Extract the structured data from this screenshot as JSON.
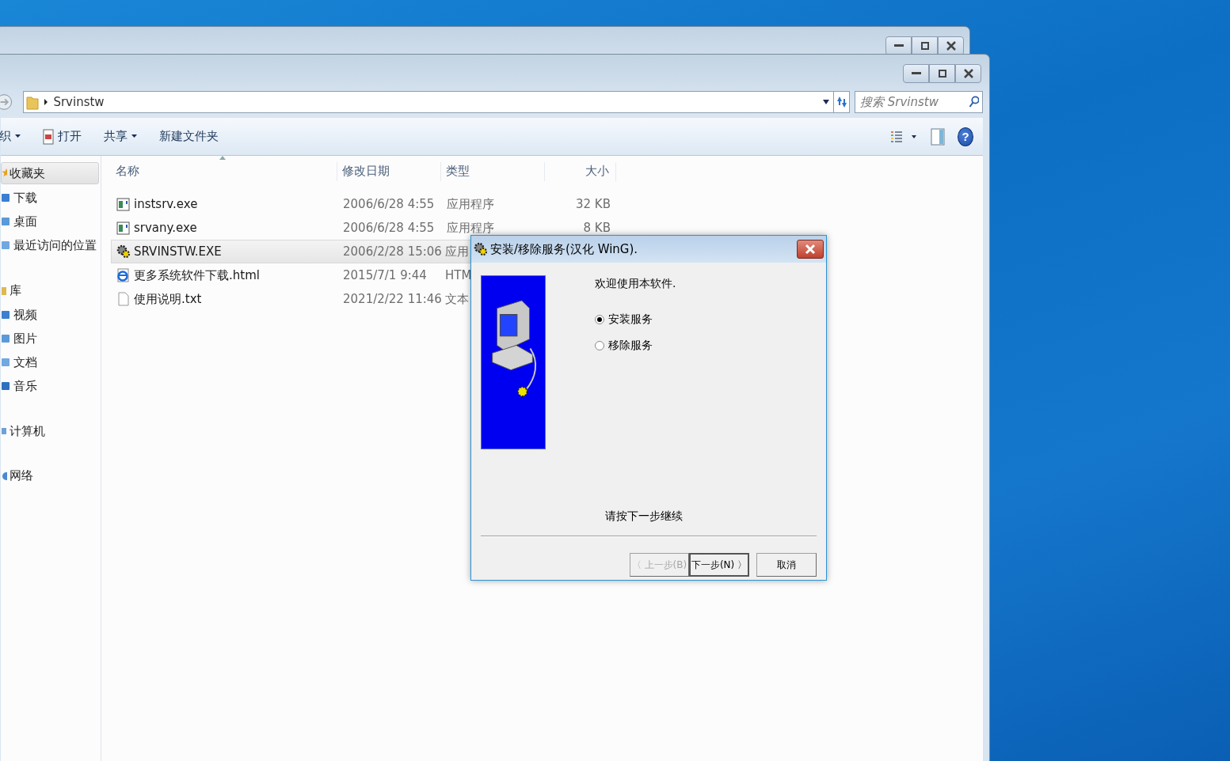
{
  "explorer": {
    "address": {
      "path": "Srvinstw"
    },
    "search": {
      "placeholder": "搜索 Srvinstw"
    },
    "toolbar": [
      {
        "label": "织",
        "kind": "menu"
      },
      {
        "label": "打开",
        "kind": "open"
      },
      {
        "label": "共享",
        "kind": "menu"
      },
      {
        "label": "新建文件夹",
        "kind": "plain"
      }
    ],
    "sidebar": [
      {
        "label": "收藏夹",
        "selected": true,
        "children": [
          {
            "label": "下载",
            "selected": false
          },
          {
            "label": "桌面",
            "selected": false
          },
          {
            "label": "最近访问的位置",
            "selected": false
          }
        ]
      },
      {
        "label": "库",
        "selected": false,
        "children": [
          {
            "label": "视频",
            "selected": false
          },
          {
            "label": "图片",
            "selected": false
          },
          {
            "label": "文档",
            "selected": false
          },
          {
            "label": "音乐",
            "selected": false
          }
        ]
      },
      {
        "label": "计算机",
        "selected": false
      },
      {
        "label": "网络",
        "selected": false
      }
    ],
    "help_button": "?",
    "columns": [
      "名称",
      "修改日期",
      "类型",
      "大小"
    ],
    "rows": [
      {
        "name": "instsrv.exe",
        "date": "2006/6/28 4:55",
        "type": "应用程序",
        "size": "32 KB",
        "kind": "app",
        "selected": false
      },
      {
        "name": "srvany.exe",
        "date": "2006/6/28 4:55",
        "type": "应用程序",
        "size": "8 KB",
        "kind": "app",
        "selected": false
      },
      {
        "name": "SRVINSTW.EXE",
        "date": "2006/2/28 15:06",
        "type": "应用",
        "size": "",
        "kind": "gear",
        "selected": true
      },
      {
        "name": "更多系统软件下载.html",
        "date": "2015/7/1 9:44",
        "type": "HTM",
        "size": "",
        "kind": "web",
        "selected": false
      },
      {
        "name": "使用说明.txt",
        "date": "2021/2/22 11:46",
        "type": "文本",
        "size": "",
        "kind": "text",
        "selected": false
      }
    ]
  },
  "dialog": {
    "title": "安装/移除服务(汉化 WinG).",
    "welcome": "欢迎使用本软件.",
    "options": [
      {
        "label": "安装服务",
        "selected": true
      },
      {
        "label": "移除服务",
        "selected": false
      }
    ],
    "hint": "请按下一步继续",
    "buttons": [
      {
        "label": "〈 上一步(B)",
        "disabled": true,
        "default": false
      },
      {
        "label": "下一步(N) 〉",
        "disabled": false,
        "default": true
      },
      {
        "label": "取消",
        "disabled": false,
        "default": false
      }
    ]
  }
}
